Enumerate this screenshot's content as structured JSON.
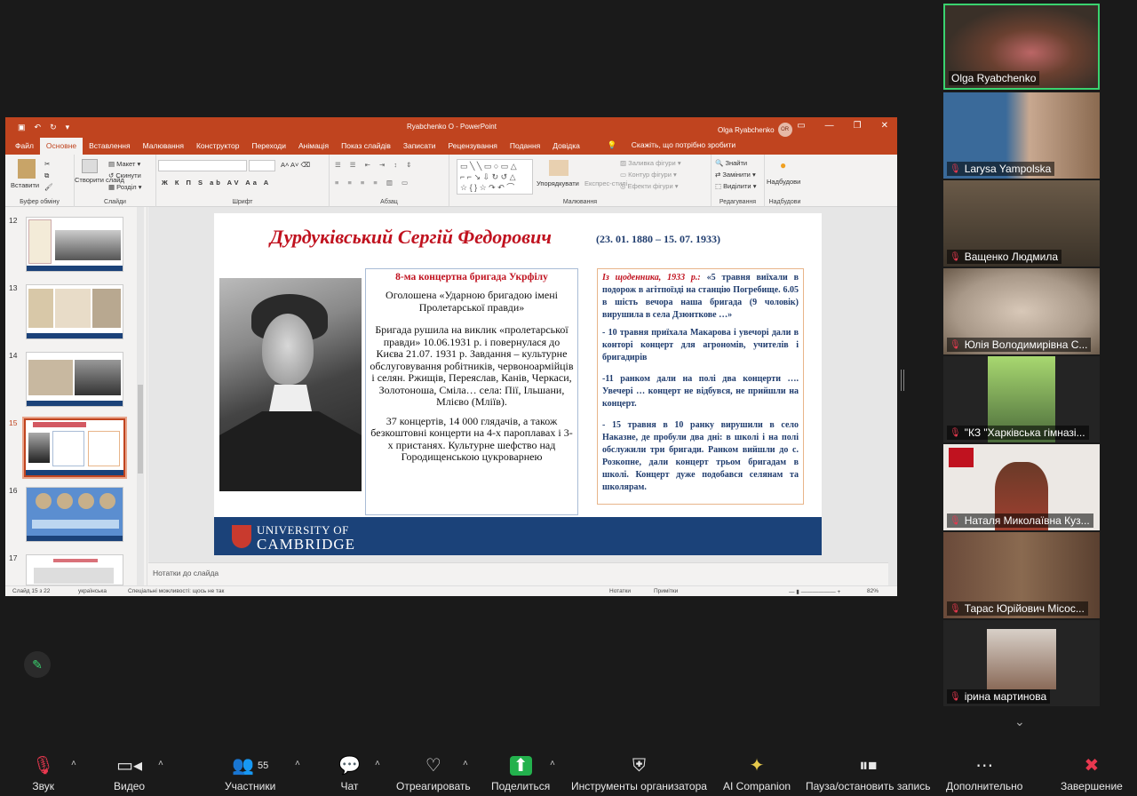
{
  "powerpoint": {
    "doc_title": "Ryabchenko O  -  PowerPoint",
    "user": "Olga Ryabchenko",
    "user_initials": "OR",
    "tabs": [
      "Файл",
      "Основне",
      "Вставлення",
      "Малювання",
      "Конструктор",
      "Переходи",
      "Анімація",
      "Показ слайдів",
      "Записати",
      "Рецензування",
      "Подання",
      "Довідка"
    ],
    "tell_me": "Скажіть, що потрібно зробити",
    "ribbon": {
      "paste": "Вставити",
      "clipboard": "Буфер обміну",
      "create_slide": "Створити слайд",
      "layout": "Макет",
      "reset": "Скинути",
      "section": "Розділ",
      "slides": "Слайди",
      "font": "Шрифт",
      "paragraph": "Абзац",
      "arrange": "Упорядкувати",
      "quick_styles": "Експрес-стилі",
      "shape_fill": "Заливка фігури",
      "shape_outline": "Контур фігури",
      "shape_effects": "Ефекти фігури",
      "drawing": "Малювання",
      "find": "Знайти",
      "replace": "Замінити",
      "select": "Виділити",
      "editing": "Редагування",
      "addins": "Надбудови",
      "addins_group": "Надбудови"
    },
    "thumbnails": [
      {
        "num": "12"
      },
      {
        "num": "13"
      },
      {
        "num": "14"
      },
      {
        "num": "15"
      },
      {
        "num": "16"
      },
      {
        "num": "17"
      }
    ],
    "notes_placeholder": "Нотатки до слайда",
    "status": {
      "slide": "Слайд 15 з 22",
      "lang": "українська",
      "accessibility": "Спеціальні можливості: щось не так",
      "notes": "Нотатки",
      "comments": "Примітки",
      "zoom": "82%"
    }
  },
  "slide": {
    "heading": "Дурдуківський Сергій Федорович",
    "dates": "(23. 01. 1880 – 15. 07. 1933)",
    "mid_title": "8-ма концертна бригада Укрфілу",
    "mid_p1": "Оголошена «Ударною бригадою імені Пролетарської правди»",
    "mid_p2": "Бригада рушила на виклик «пролетарської правди» 10.06.1931 р. і повернулася до Києва 21.07. 1931 р. Завдання – культурне обслуговування робітників, червоноармійців і селян. Ржищів, Переяслав, Канів, Черкаси, Золотоноша, Сміла… села: Пії, Ільшани, Млієво (Мліїв).",
    "mid_p3": "37 концертів, 14 000 глядачів, а також безкоштовні концерти на 4-х пароплавах і 3-х пристанях. Культурне шефство над Городищенською цукроварнею",
    "right_lead": "Із щоденника, 1933 р.:",
    "right_p1": " «5 травня виїхали в подорож в агітпоїзді на станцію Погребище. 6.05 в шість вечора наша бригада (9 чоловік) вирушила в села Дзюнткове …»",
    "right_p2": "- 10 травня приїхала Макарова і увечорі дали в конторі концерт для агрономів, учителів і бригадирів",
    "right_p3": "-11 ранком дали на полі два концерти …. Увечері … концерт не відбувся, не прийшли на концерт.",
    "right_p4": "- 15 травня в 10 ранку вирушили в село Наказне, де пробули два дні: в школі і на полі обслужили три бригади. Ранком вийшли до с. Розкопне, дали концерт трьом бригадам в школі. Концерт дуже подобався селянам та школярам.",
    "uni_line1": "UNIVERSITY OF",
    "uni_line2": "CAMBRIDGE"
  },
  "participants": [
    {
      "name": "Olga Ryabchenko",
      "muted": false,
      "active": true,
      "bg": "#5a4a3a"
    },
    {
      "name": "Larysa Yampolska",
      "muted": true,
      "active": false,
      "bg": "#4a6a8a"
    },
    {
      "name": "Ващенко Людмила",
      "muted": true,
      "active": false,
      "bg": "#5a5040"
    },
    {
      "name": "Юлія Володимирівна С...",
      "muted": true,
      "active": false,
      "bg": "#a89a8a"
    },
    {
      "name": "\"КЗ \"Харківська гімназі...",
      "muted": true,
      "active": false,
      "bg": "#3a3a3a"
    },
    {
      "name": "Наталя Миколаївна Куз...",
      "muted": true,
      "active": false,
      "bg": "#e8e4e0"
    },
    {
      "name": "Тарас Юрійович Місос...",
      "muted": true,
      "active": false,
      "bg": "#6a5040"
    },
    {
      "name": "ірина мартинова",
      "muted": true,
      "active": false,
      "bg": "#2a2a2a"
    }
  ],
  "toolbar": {
    "audio": "Звук",
    "video": "Видео",
    "participants": "Участники",
    "participants_count": "55",
    "chat": "Чат",
    "react": "Отреагировать",
    "share": "Поделиться",
    "host_tools": "Инструменты организатора",
    "ai": "AI Companion",
    "record": "Пауза/остановить запись",
    "more": "Дополнительно",
    "end": "Завершение"
  }
}
